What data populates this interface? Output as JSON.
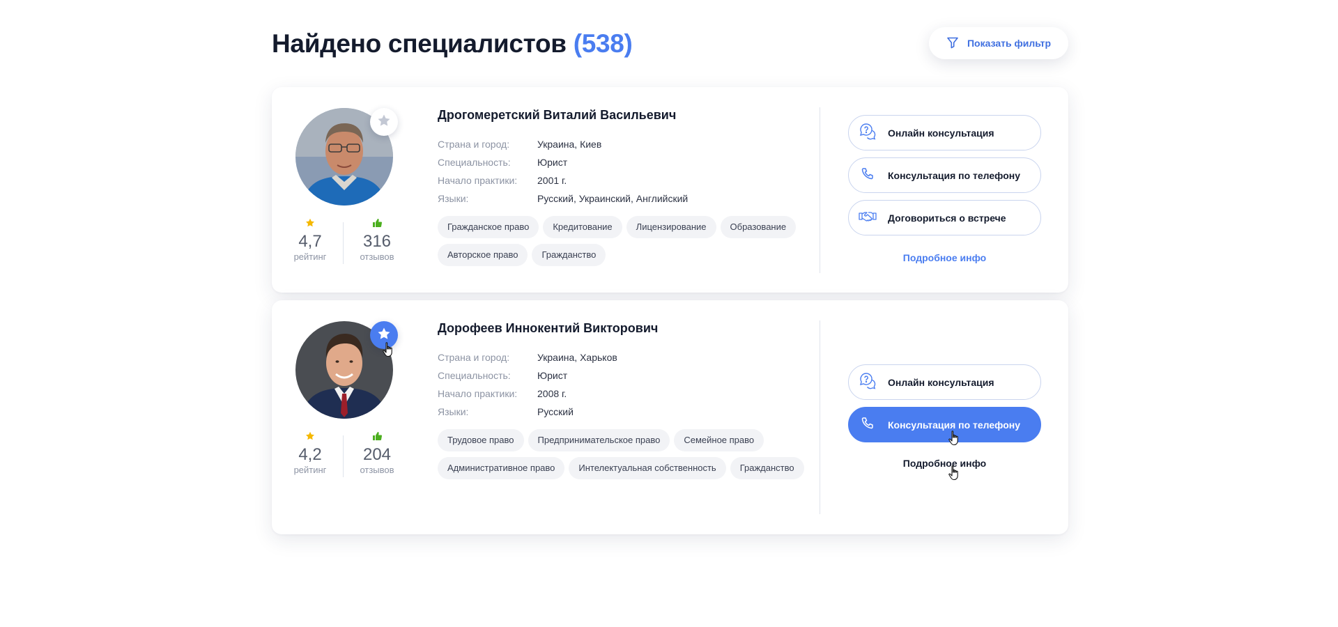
{
  "header": {
    "title": "Найдено специалистов",
    "count": "(538)",
    "filter_label": "Показать фильтр"
  },
  "colors": {
    "accent": "#4a7df0",
    "star": "#f5b800",
    "thumb": "#4caf1f"
  },
  "specialists": [
    {
      "name": "Дрогомеретский Виталий Васильевич",
      "favorite": false,
      "rating": "4,7",
      "rating_label": "рейтинг",
      "reviews": "316",
      "reviews_label": "отзывов",
      "fields": [
        {
          "k": "Страна и город:",
          "v": "Украина, Киев"
        },
        {
          "k": "Специальность:",
          "v": "Юрист"
        },
        {
          "k": "Начало практики:",
          "v": "2001 г."
        },
        {
          "k": "Языки:",
          "v": "Русский, Украинский, Английский"
        }
      ],
      "tags": [
        "Гражданское право",
        "Кредитование",
        "Лицензирование",
        "Образование",
        "Авторское право",
        "Гражданство"
      ],
      "actions": [
        {
          "label": "Онлайн консультация",
          "icon": "chat-question-icon"
        },
        {
          "label": "Консультация по телефону",
          "icon": "phone-icon"
        },
        {
          "label": "Договориться о встрече",
          "icon": "handshake-icon"
        }
      ],
      "more": "Подробное инфо"
    },
    {
      "name": "Дорофеев Иннокентий Викторович",
      "favorite": true,
      "rating": "4,2",
      "rating_label": "рейтинг",
      "reviews": "204",
      "reviews_label": "отзывов",
      "fields": [
        {
          "k": "Страна и город:",
          "v": "Украина, Харьков"
        },
        {
          "k": "Специальность:",
          "v": "Юрист"
        },
        {
          "k": "Начало практики:",
          "v": "2008 г."
        },
        {
          "k": "Языки:",
          "v": "Русский"
        }
      ],
      "tags": [
        "Трудовое право",
        "Предпринимательское право",
        "Семейное право",
        "Административное право",
        "Интелектуальная собственность",
        "Гражданство"
      ],
      "actions": [
        {
          "label": "Онлайн консультация",
          "icon": "chat-question-icon"
        },
        {
          "label": "Консультация по телефону",
          "icon": "phone-icon"
        }
      ],
      "more": "Подробное инфо"
    }
  ]
}
